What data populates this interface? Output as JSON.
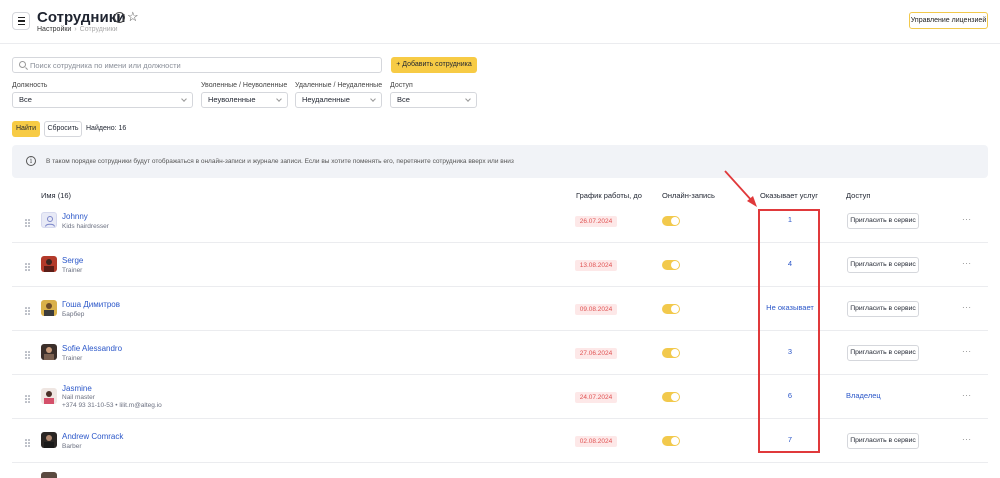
{
  "header": {
    "title": "Сотрудники",
    "breadcrumb": [
      "Настройки",
      "Сотрудники"
    ],
    "license_button": "Управление лицензией"
  },
  "search": {
    "placeholder": "Поиск сотрудника по имени или должности",
    "value": ""
  },
  "add_button": "+ Добавить сотрудника",
  "filters": [
    {
      "label": "Должность",
      "value": "Все"
    },
    {
      "label": "Уволенные / Неуволенные",
      "value": "Неуволенные"
    },
    {
      "label": "Удаленные / Неудаленные",
      "value": "Неудаленные"
    },
    {
      "label": "Доступ",
      "value": "Все"
    }
  ],
  "actions": {
    "find": "Найти",
    "reset": "Сбросить",
    "found": "Найдено: 16"
  },
  "banner": "В таком порядке сотрудники будут отображаться в онлайн-записи и журнале записи. Если вы хотите поменять его, перетяните сотрудника вверх или вниз",
  "table": {
    "columns": [
      "Имя (16)",
      "График работы, до",
      "Онлайн-запись",
      "Оказывает услуг",
      "Доступ"
    ],
    "rows": [
      {
        "name": "Johnny",
        "role": "Kids hairdresser",
        "contact": "",
        "schedule": "26.07.2024",
        "online": true,
        "services": "1",
        "access": "Пригласить в сервис",
        "avatar": "placeholder"
      },
      {
        "name": "Serge",
        "role": "Trainer",
        "contact": "",
        "schedule": "13.08.2024",
        "online": true,
        "services": "4",
        "access": "Пригласить в сервис",
        "avatar": "photo-red"
      },
      {
        "name": "Гоша Димитров",
        "role": "Барбер",
        "contact": "",
        "schedule": "09.08.2024",
        "online": true,
        "services": "Не оказывает",
        "access": "Пригласить в сервис",
        "avatar": "photo-yellow"
      },
      {
        "name": "Sofie Alessandro",
        "role": "Trainer",
        "contact": "",
        "schedule": "27.06.2024",
        "online": true,
        "services": "3",
        "access": "Пригласить в сервис",
        "avatar": "photo-dark"
      },
      {
        "name": "Jasmine",
        "role": "Nail master",
        "contact": "+374 93 31-10-53 • lilit.m@alteg.io",
        "schedule": "24.07.2024",
        "online": true,
        "services": "6",
        "access": "Владелец",
        "avatar": "photo-light"
      },
      {
        "name": "Andrew Comrack",
        "role": "Barber",
        "contact": "",
        "schedule": "02.08.2024",
        "online": true,
        "services": "7",
        "access": "Пригласить в сервис",
        "avatar": "photo-dark"
      }
    ]
  },
  "colors": {
    "accent": "#f7cb45",
    "link": "#2b57c9",
    "annotation": "#e0393b",
    "badge_bg": "#fde8e8",
    "badge_text": "#e05252"
  }
}
